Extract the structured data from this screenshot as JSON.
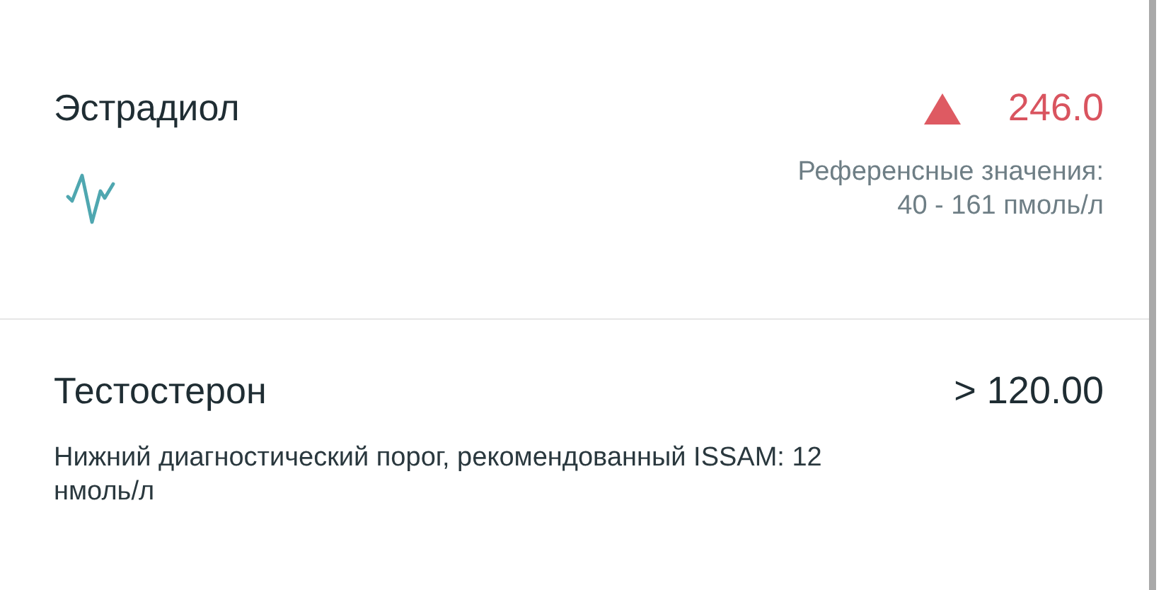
{
  "results": [
    {
      "name": "Эстрадиол",
      "value": "246.0",
      "flagged_high": true,
      "trend_icon": true,
      "reference_lines": [
        "Референсные значения:",
        "40 - 161 пмоль/л"
      ]
    },
    {
      "name": "Тестостерон",
      "value": "> 120.00",
      "flagged_high": false,
      "trend_icon": false,
      "note": "Нижний диагностический порог, рекомендованный ISSAM: 12 нмоль/л"
    }
  ]
}
